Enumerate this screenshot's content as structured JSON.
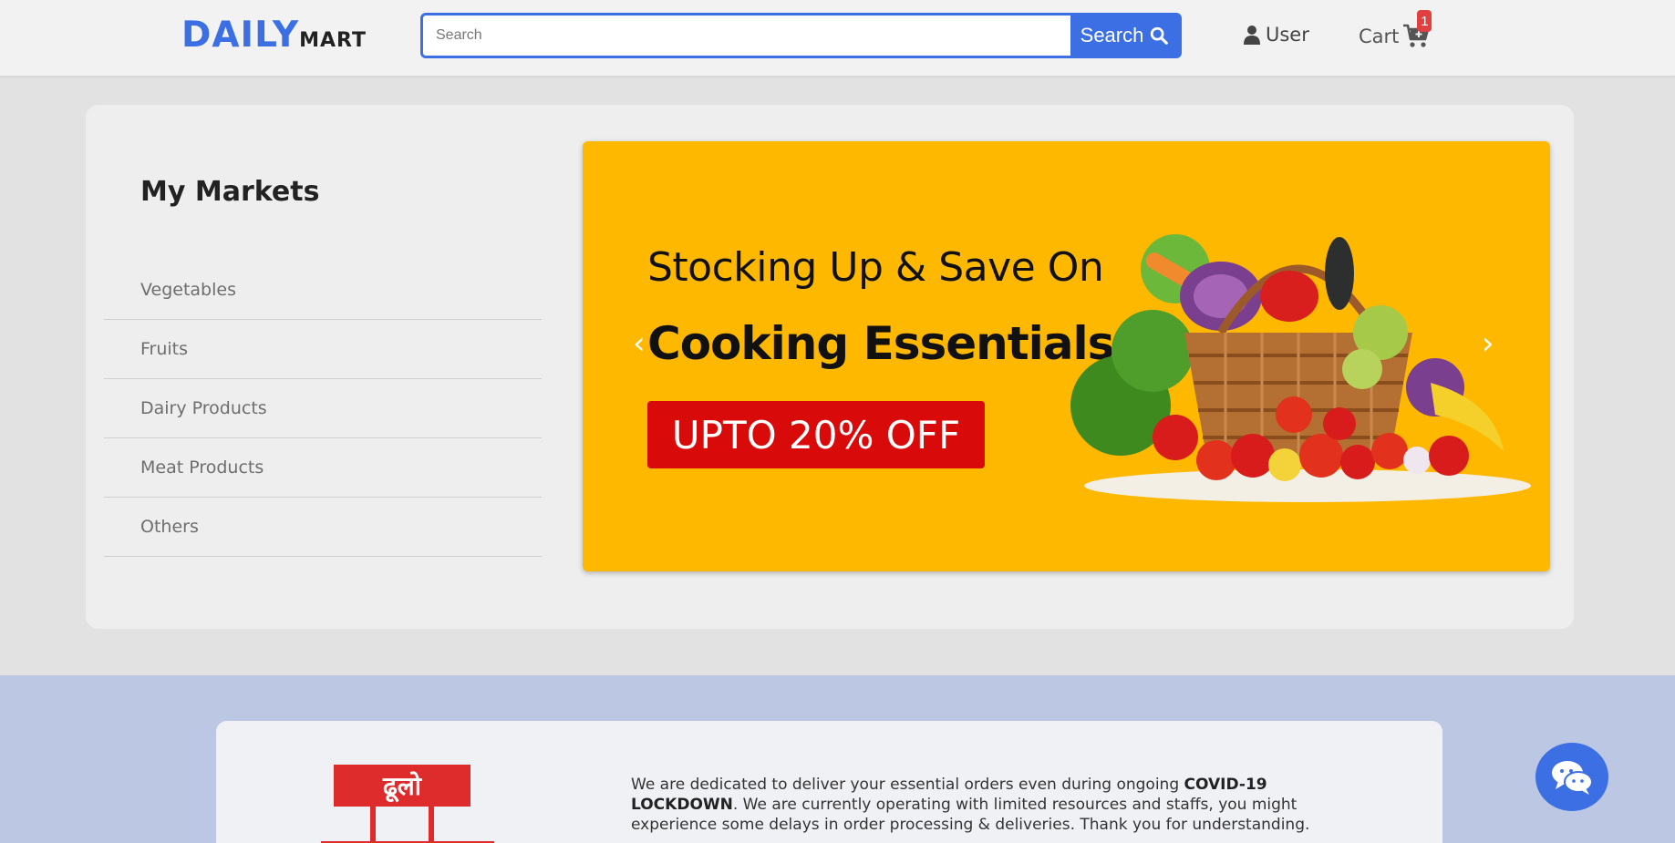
{
  "header": {
    "logo_main": "DAILY",
    "logo_sub": "MART",
    "search_placeholder": "Search",
    "search_button": "Search",
    "user_label": "User",
    "cart_label": "Cart",
    "cart_count": "1"
  },
  "markets": {
    "title": "My Markets",
    "items": [
      {
        "label": "Vegetables"
      },
      {
        "label": "Fruits"
      },
      {
        "label": "Dairy Products"
      },
      {
        "label": "Meat Products"
      },
      {
        "label": "Others"
      }
    ]
  },
  "banner": {
    "line1": "Stocking Up & Save On",
    "line2": "Cooking Essentials",
    "offer": "UPTO 20% OFF",
    "prev_icon": "chevron-left-icon",
    "next_icon": "chevron-right-icon",
    "background": "#ffb800"
  },
  "info": {
    "logo_text": "ढूलो",
    "text_start": "We are dedicated to deliver your essential orders even during ongoing ",
    "text_bold1": "COVID-19",
    "text_bold2": "LOCKDOWN",
    "text_end": ". We are currently operating with limited resources and staffs, you might experience some delays in order processing & deliveries. Thank you for understanding."
  },
  "colors": {
    "accent": "#3b6fe3",
    "badge": "#e04040",
    "offer": "#d90a0a"
  },
  "chat": {
    "icon": "chat-icon"
  }
}
